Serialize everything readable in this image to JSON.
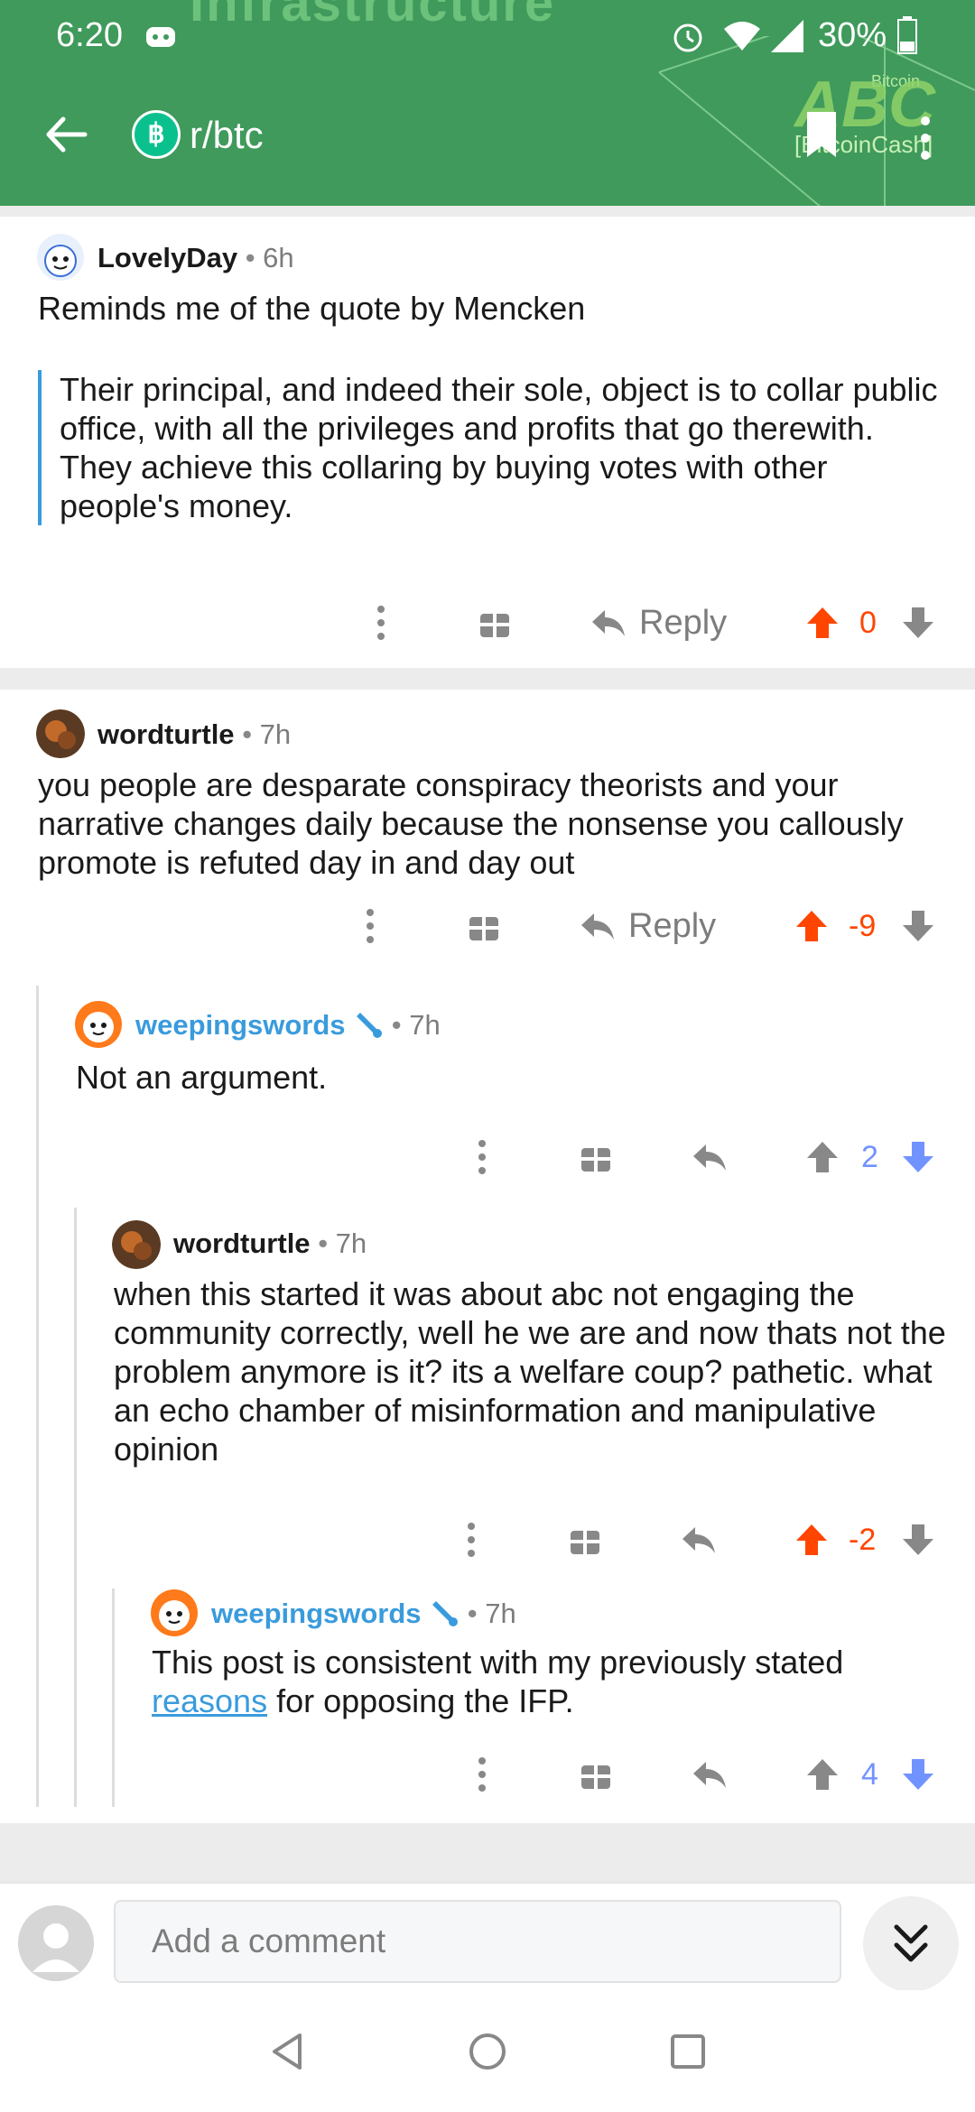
{
  "status_bar": {
    "time": "6:20",
    "battery": "30%"
  },
  "header": {
    "subreddit": "r/btc",
    "banner_text": "Infrastructure",
    "abc_logo": "ABC",
    "abc_small": "Bitcoin",
    "bch_text": "[BitcoinCash]"
  },
  "comments": [
    {
      "author": "LovelyDay",
      "age": "6h",
      "mod": false,
      "body": "Reminds me of the quote by Mencken",
      "quote": "Their principal, and indeed their sole, object is to collar public office, with all the privileges and profits that go therewith. They achieve this collaring by buying votes with other people's money.",
      "reply_label": "Reply",
      "score": "0"
    },
    {
      "author": "wordturtle",
      "age": "7h",
      "mod": false,
      "body": "you people are desparate conspiracy theorists and your narrative changes daily because the nonsense you callously promote is refuted day in and day out",
      "reply_label": "Reply",
      "score": "-9"
    },
    {
      "author": "weepingswords",
      "age": "7h",
      "mod": true,
      "body": "Not an argument.",
      "score": "2"
    },
    {
      "author": "wordturtle",
      "age": "7h",
      "mod": false,
      "body": "when this started it was about abc not engaging the community correctly, well he we are and now thats not the problem anymore is it?  its a welfare coup?  pathetic.  what an echo chamber of misinformation and manipulative opinion",
      "score": "-2"
    },
    {
      "author": "weepingswords",
      "age": "7h",
      "mod": true,
      "body_before": "This post is consistent with my previously stated ",
      "body_link": "reasons",
      "body_after": " for opposing the IFP.",
      "score": "4"
    }
  ],
  "composer": {
    "placeholder": "Add a comment"
  },
  "colors": {
    "header_green": "#3f9a5b",
    "upvote_orange": "#ff4500",
    "downvote_blue": "#7193ff",
    "mod_blue": "#3a9bdc"
  }
}
